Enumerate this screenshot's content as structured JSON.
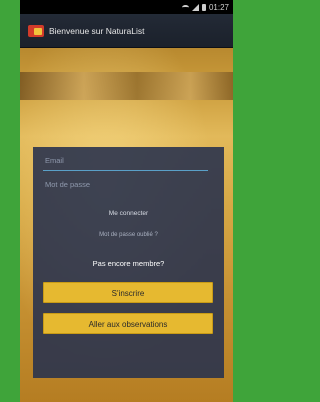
{
  "status_bar": {
    "time": "01:27"
  },
  "action_bar": {
    "title": "Bienvenue sur NaturaList"
  },
  "login": {
    "email_placeholder": "Email",
    "password_placeholder": "Mot de passe",
    "connect_link": "Me connecter",
    "forgot_link": "Mot de passe oublié ?",
    "not_member_text": "Pas encore membre?",
    "signup_button": "S'inscrire",
    "observations_button": "Aller aux observations"
  }
}
